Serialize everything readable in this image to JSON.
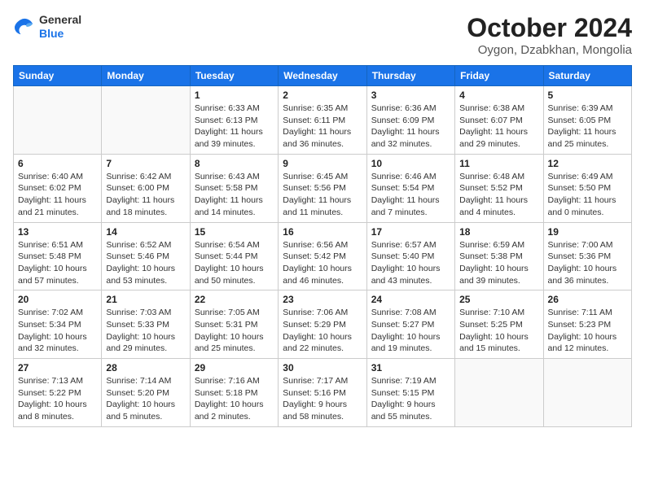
{
  "header": {
    "logo": {
      "general": "General",
      "blue": "Blue"
    },
    "title": "October 2024",
    "location": "Oygon, Dzabkhan, Mongolia"
  },
  "calendar": {
    "days_of_week": [
      "Sunday",
      "Monday",
      "Tuesday",
      "Wednesday",
      "Thursday",
      "Friday",
      "Saturday"
    ],
    "weeks": [
      [
        {
          "day": "",
          "detail": ""
        },
        {
          "day": "",
          "detail": ""
        },
        {
          "day": "1",
          "detail": "Sunrise: 6:33 AM\nSunset: 6:13 PM\nDaylight: 11 hours and 39 minutes."
        },
        {
          "day": "2",
          "detail": "Sunrise: 6:35 AM\nSunset: 6:11 PM\nDaylight: 11 hours and 36 minutes."
        },
        {
          "day": "3",
          "detail": "Sunrise: 6:36 AM\nSunset: 6:09 PM\nDaylight: 11 hours and 32 minutes."
        },
        {
          "day": "4",
          "detail": "Sunrise: 6:38 AM\nSunset: 6:07 PM\nDaylight: 11 hours and 29 minutes."
        },
        {
          "day": "5",
          "detail": "Sunrise: 6:39 AM\nSunset: 6:05 PM\nDaylight: 11 hours and 25 minutes."
        }
      ],
      [
        {
          "day": "6",
          "detail": "Sunrise: 6:40 AM\nSunset: 6:02 PM\nDaylight: 11 hours and 21 minutes."
        },
        {
          "day": "7",
          "detail": "Sunrise: 6:42 AM\nSunset: 6:00 PM\nDaylight: 11 hours and 18 minutes."
        },
        {
          "day": "8",
          "detail": "Sunrise: 6:43 AM\nSunset: 5:58 PM\nDaylight: 11 hours and 14 minutes."
        },
        {
          "day": "9",
          "detail": "Sunrise: 6:45 AM\nSunset: 5:56 PM\nDaylight: 11 hours and 11 minutes."
        },
        {
          "day": "10",
          "detail": "Sunrise: 6:46 AM\nSunset: 5:54 PM\nDaylight: 11 hours and 7 minutes."
        },
        {
          "day": "11",
          "detail": "Sunrise: 6:48 AM\nSunset: 5:52 PM\nDaylight: 11 hours and 4 minutes."
        },
        {
          "day": "12",
          "detail": "Sunrise: 6:49 AM\nSunset: 5:50 PM\nDaylight: 11 hours and 0 minutes."
        }
      ],
      [
        {
          "day": "13",
          "detail": "Sunrise: 6:51 AM\nSunset: 5:48 PM\nDaylight: 10 hours and 57 minutes."
        },
        {
          "day": "14",
          "detail": "Sunrise: 6:52 AM\nSunset: 5:46 PM\nDaylight: 10 hours and 53 minutes."
        },
        {
          "day": "15",
          "detail": "Sunrise: 6:54 AM\nSunset: 5:44 PM\nDaylight: 10 hours and 50 minutes."
        },
        {
          "day": "16",
          "detail": "Sunrise: 6:56 AM\nSunset: 5:42 PM\nDaylight: 10 hours and 46 minutes."
        },
        {
          "day": "17",
          "detail": "Sunrise: 6:57 AM\nSunset: 5:40 PM\nDaylight: 10 hours and 43 minutes."
        },
        {
          "day": "18",
          "detail": "Sunrise: 6:59 AM\nSunset: 5:38 PM\nDaylight: 10 hours and 39 minutes."
        },
        {
          "day": "19",
          "detail": "Sunrise: 7:00 AM\nSunset: 5:36 PM\nDaylight: 10 hours and 36 minutes."
        }
      ],
      [
        {
          "day": "20",
          "detail": "Sunrise: 7:02 AM\nSunset: 5:34 PM\nDaylight: 10 hours and 32 minutes."
        },
        {
          "day": "21",
          "detail": "Sunrise: 7:03 AM\nSunset: 5:33 PM\nDaylight: 10 hours and 29 minutes."
        },
        {
          "day": "22",
          "detail": "Sunrise: 7:05 AM\nSunset: 5:31 PM\nDaylight: 10 hours and 25 minutes."
        },
        {
          "day": "23",
          "detail": "Sunrise: 7:06 AM\nSunset: 5:29 PM\nDaylight: 10 hours and 22 minutes."
        },
        {
          "day": "24",
          "detail": "Sunrise: 7:08 AM\nSunset: 5:27 PM\nDaylight: 10 hours and 19 minutes."
        },
        {
          "day": "25",
          "detail": "Sunrise: 7:10 AM\nSunset: 5:25 PM\nDaylight: 10 hours and 15 minutes."
        },
        {
          "day": "26",
          "detail": "Sunrise: 7:11 AM\nSunset: 5:23 PM\nDaylight: 10 hours and 12 minutes."
        }
      ],
      [
        {
          "day": "27",
          "detail": "Sunrise: 7:13 AM\nSunset: 5:22 PM\nDaylight: 10 hours and 8 minutes."
        },
        {
          "day": "28",
          "detail": "Sunrise: 7:14 AM\nSunset: 5:20 PM\nDaylight: 10 hours and 5 minutes."
        },
        {
          "day": "29",
          "detail": "Sunrise: 7:16 AM\nSunset: 5:18 PM\nDaylight: 10 hours and 2 minutes."
        },
        {
          "day": "30",
          "detail": "Sunrise: 7:17 AM\nSunset: 5:16 PM\nDaylight: 9 hours and 58 minutes."
        },
        {
          "day": "31",
          "detail": "Sunrise: 7:19 AM\nSunset: 5:15 PM\nDaylight: 9 hours and 55 minutes."
        },
        {
          "day": "",
          "detail": ""
        },
        {
          "day": "",
          "detail": ""
        }
      ]
    ]
  }
}
